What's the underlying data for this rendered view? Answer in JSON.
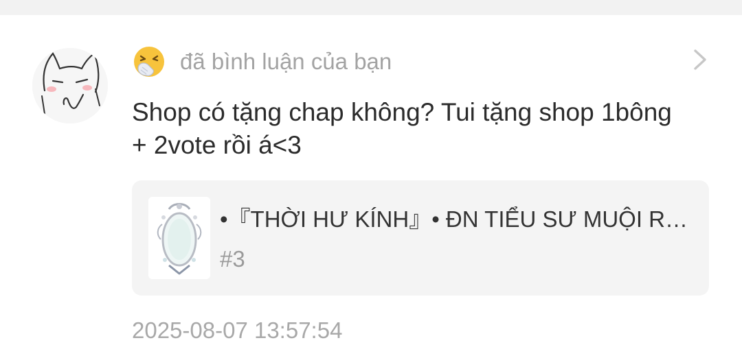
{
  "notification": {
    "reaction_icon": "sneezing-face-emoji",
    "action_text": "đã bình luận của bạn",
    "comment": "Shop có tặng chap không? Tui tặng shop 1bông + 2vote rồi á<3",
    "story": {
      "title": "•『THỜI HƯ KÍNH』• ĐN TIỂU SƯ MUỘI RẤT KHÓ NUÔI",
      "chapter": "#3",
      "cover_icon": "ornate-mirror-image"
    },
    "timestamp": "2025-08-07 13:57:54"
  },
  "icons": {
    "avatar": "sketch-cat-avatar",
    "chevron": "chevron-right-icon"
  },
  "colors": {
    "text_primary": "#2b2b2b",
    "text_muted": "#a3a3a3",
    "card_background": "#f4f4f4",
    "emoji_yellow": "#f7c33c"
  }
}
